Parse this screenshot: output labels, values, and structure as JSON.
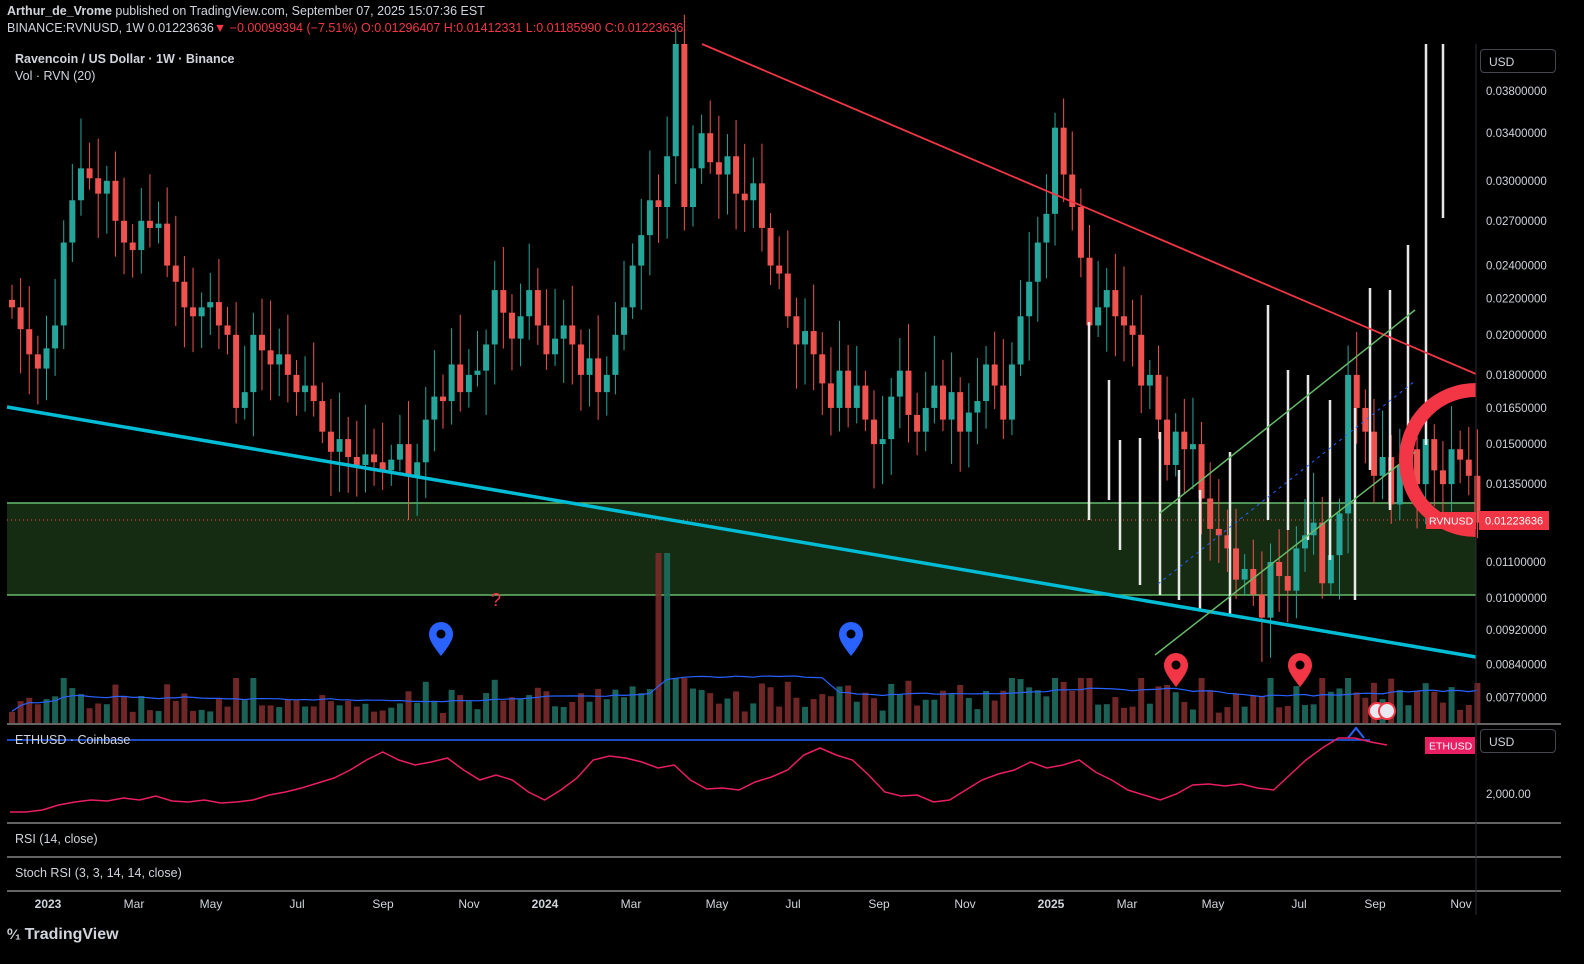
{
  "header": {
    "author": "Arthur_de_Vrome",
    "published": "published on TradingView.com, September 07, 2025 15:07:36 EST",
    "symbol": "BINANCE:RVNUSD, 1W",
    "price": "0.01223636",
    "change": "▼ −0.00099394 (−7.51%)",
    "ohlc": "O:0.01296407 H:0.01412331 L:0.01185990 C:0.01223636"
  },
  "legend": {
    "title": "Ravencoin / US Dollar · 1W · Binance",
    "volume": "Vol · RVN (20)"
  },
  "panes": {
    "eth_label": "ETHUSD · Coinbase",
    "rsi_label": "RSI (14, close)",
    "stoch_label": "Stoch RSI (3, 3, 14, 14, close)",
    "unit_main": "USD",
    "unit_eth": "USD",
    "eth_tag": "ETHUSD",
    "eth_tick": "2,000.00",
    "price_tag_symbol": "RVNUSD",
    "price_tag_value": "0.01223636"
  },
  "footer": {
    "brand": "TradingView"
  },
  "colors": {
    "bull": "#26a69a",
    "bear": "#ef5350",
    "trend_red": "#f23645",
    "trend_cyan": "#00bcd4",
    "channel_green": "#66bb6a",
    "eth": "#e91e63",
    "vol_ma": "#2962ff",
    "marker_blue": "#2962ff",
    "marker_red": "#f23645"
  },
  "chart_data": {
    "type": "candlestick",
    "title": "Ravencoin / US Dollar · 1W · Binance",
    "yscale": "log",
    "ylim": [
      0.0072,
      0.043
    ],
    "y_ticks": [
      "0.03800000",
      "0.03400000",
      "0.03000000",
      "0.02700000",
      "0.02400000",
      "0.02200000",
      "0.02000000",
      "0.01800000",
      "0.01650000",
      "0.01500000",
      "0.01350000",
      "0.01100000",
      "0.01000000",
      "0.00920000",
      "0.00840000",
      "0.00770000"
    ],
    "x_ticks": [
      "2023",
      "Mar",
      "May",
      "Jul",
      "Sep",
      "Nov",
      "2024",
      "Mar",
      "May",
      "Jul",
      "Sep",
      "Nov",
      "2025",
      "Mar",
      "May",
      "Jul",
      "Sep",
      "Nov"
    ],
    "support_zone": [
      0.01,
      0.01275
    ],
    "last_price": 0.01223636,
    "closes": [
      0.0215,
      0.0203,
      0.019,
      0.0183,
      0.0193,
      0.0205,
      0.0255,
      0.0285,
      0.031,
      0.0302,
      0.029,
      0.03,
      0.027,
      0.0255,
      0.025,
      0.027,
      0.0265,
      0.0268,
      0.024,
      0.023,
      0.0215,
      0.021,
      0.0215,
      0.0218,
      0.0205,
      0.02,
      0.0165,
      0.0172,
      0.02,
      0.0192,
      0.0185,
      0.019,
      0.018,
      0.0172,
      0.0175,
      0.0168,
      0.0155,
      0.0147,
      0.0152,
      0.0145,
      0.0142,
      0.0146,
      0.0143,
      0.014,
      0.0144,
      0.015,
      0.0138,
      0.0143,
      0.016,
      0.017,
      0.0168,
      0.0185,
      0.0172,
      0.018,
      0.0182,
      0.0195,
      0.0225,
      0.0212,
      0.0198,
      0.021,
      0.0225,
      0.0205,
      0.019,
      0.0198,
      0.0205,
      0.0195,
      0.018,
      0.0188,
      0.0172,
      0.018,
      0.02,
      0.0215,
      0.024,
      0.026,
      0.0285,
      0.028,
      0.032,
      0.043,
      0.028,
      0.031,
      0.034,
      0.0315,
      0.0305,
      0.032,
      0.029,
      0.0285,
      0.0298,
      0.0265,
      0.024,
      0.0235,
      0.021,
      0.0195,
      0.0202,
      0.019,
      0.0176,
      0.0165,
      0.0182,
      0.0165,
      0.0175,
      0.016,
      0.015,
      0.0152,
      0.017,
      0.0182,
      0.0162,
      0.0155,
      0.0165,
      0.0175,
      0.016,
      0.0172,
      0.0155,
      0.0163,
      0.0168,
      0.0185,
      0.0175,
      0.016,
      0.0185,
      0.021,
      0.023,
      0.0255,
      0.0275,
      0.0345,
      0.0305,
      0.028,
      0.0245,
      0.0205,
      0.0215,
      0.0225,
      0.021,
      0.0205,
      0.02,
      0.0175,
      0.018,
      0.016,
      0.0142,
      0.0155,
      0.0148,
      0.015,
      0.013,
      0.012,
      0.0118,
      0.0114,
      0.0105,
      0.0108,
      0.0101,
      0.0095,
      0.011,
      0.0106,
      0.0102,
      0.0114,
      0.0118,
      0.0122,
      0.0104,
      0.0112,
      0.0125,
      0.018,
      0.0165,
      0.0155,
      0.0138,
      0.0145,
      0.0128,
      0.0142,
      0.0148,
      0.0135,
      0.0152,
      0.014,
      0.0135,
      0.0148,
      0.0144,
      0.0138,
      0.0122
    ]
  }
}
